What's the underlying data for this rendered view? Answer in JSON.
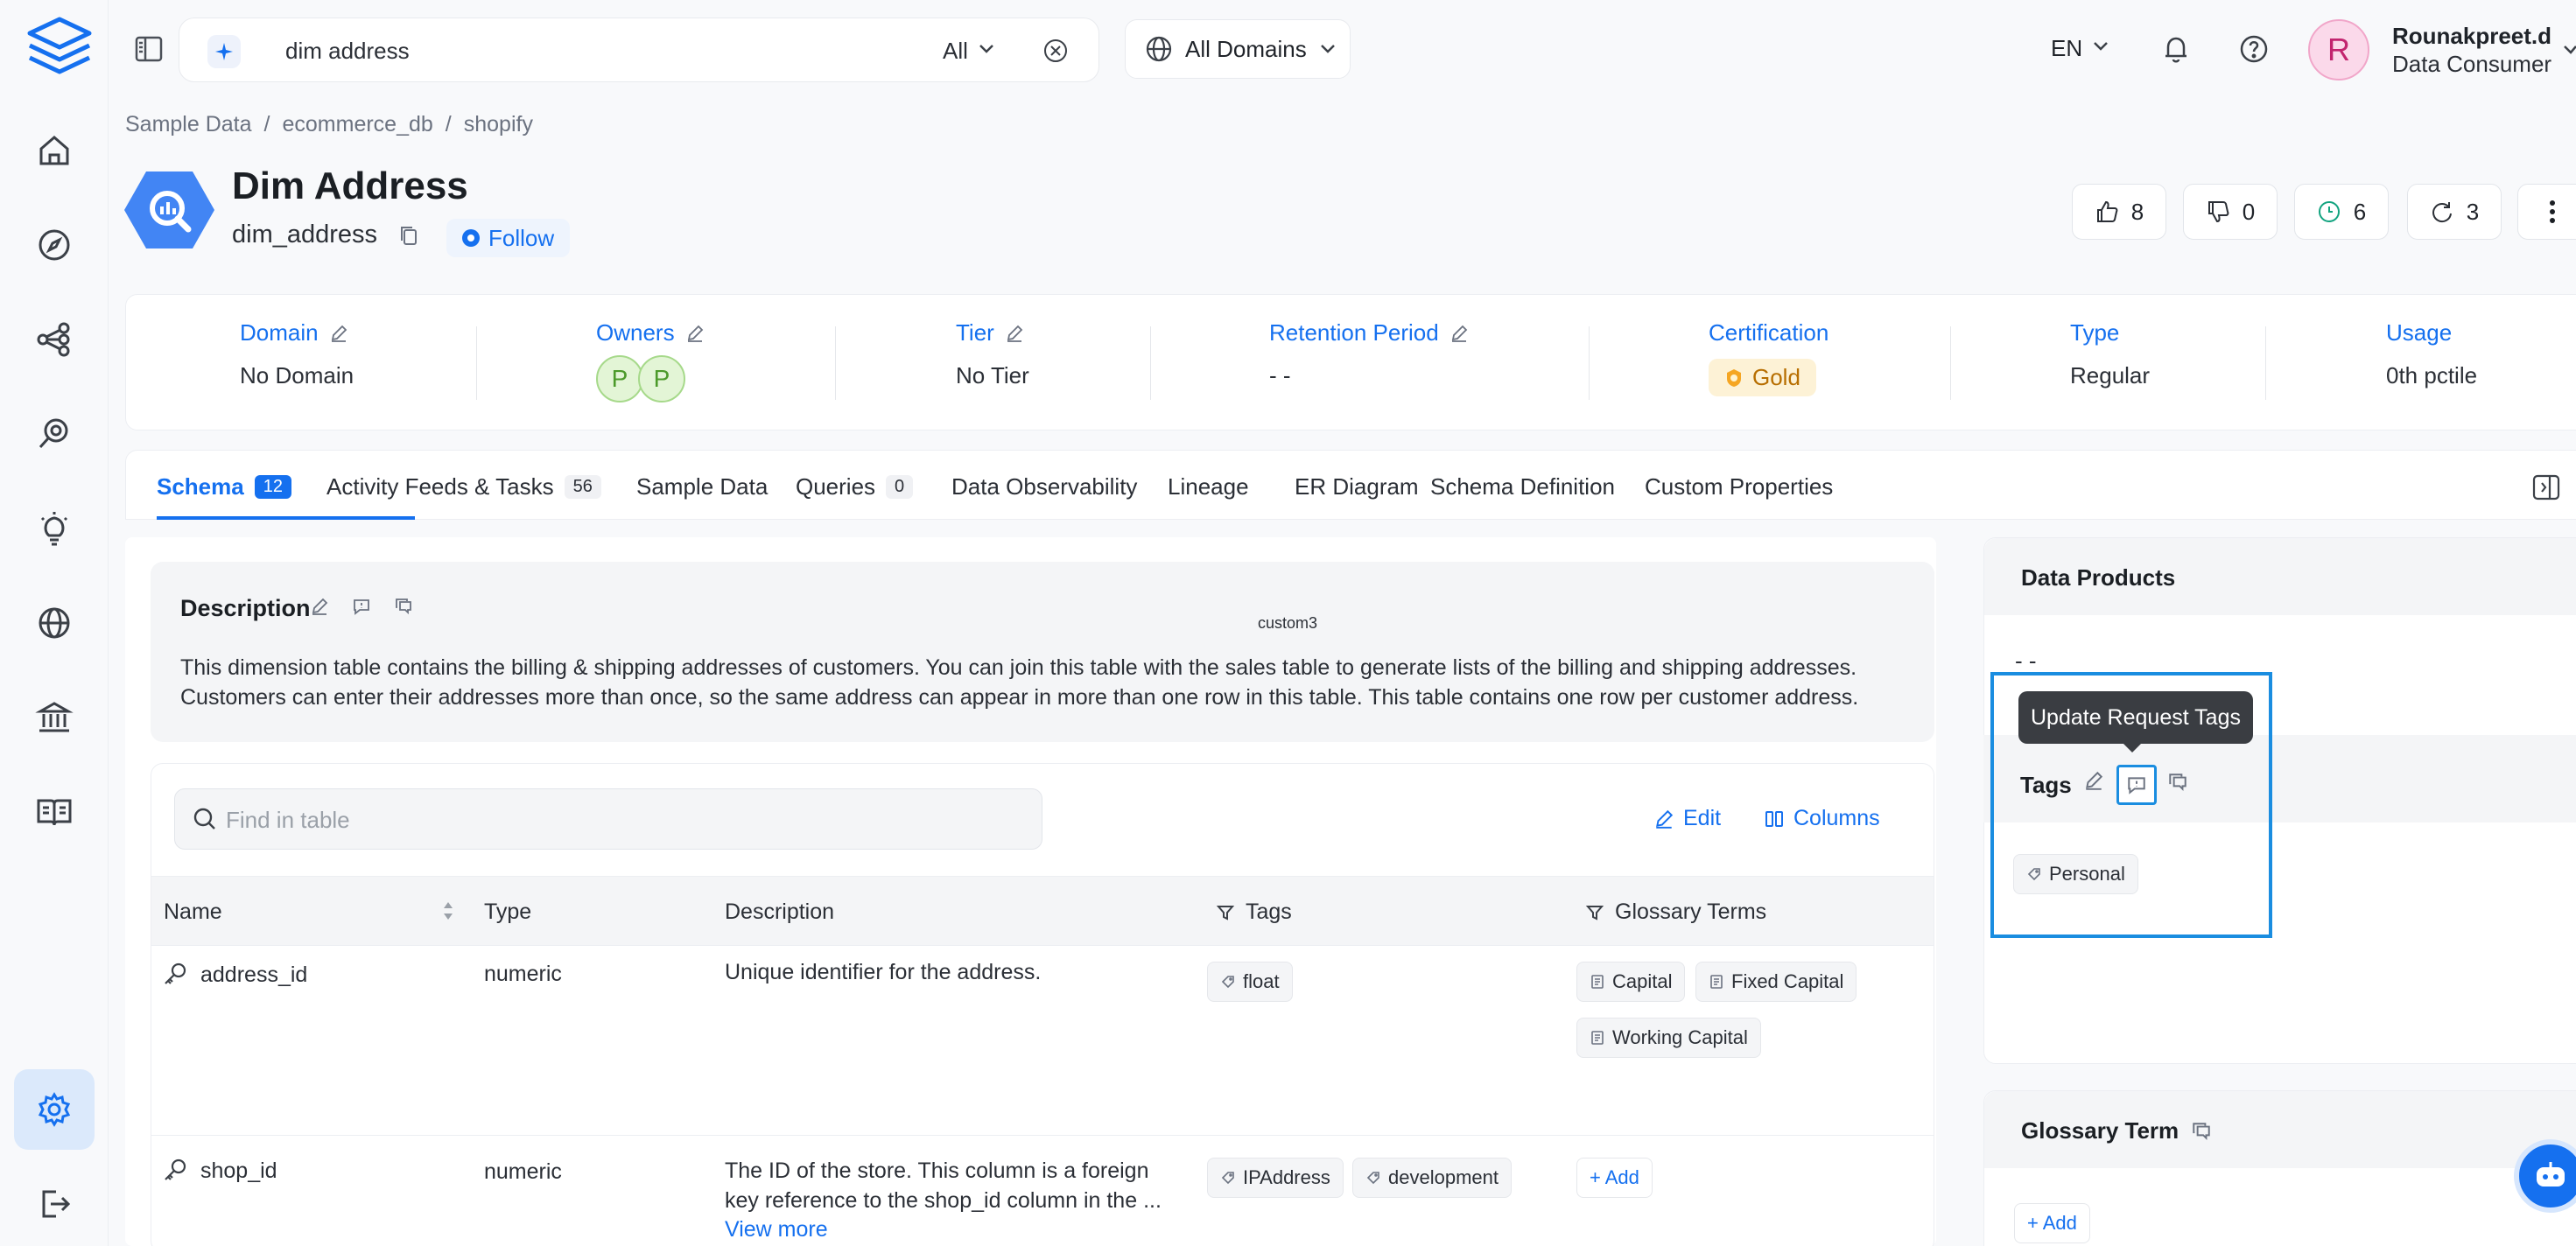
{
  "search": {
    "query": "dim address",
    "scope": "All"
  },
  "domains_label": "All Domains",
  "language": "EN",
  "user": {
    "initial": "R",
    "name": "Rounakpreet.d",
    "role": "Data Consumer"
  },
  "breadcrumbs": [
    "Sample Data",
    "ecommerce_db",
    "shopify"
  ],
  "breadcrumb_separator": "/",
  "entity": {
    "display_name": "Dim Address",
    "name": "dim_address",
    "follow_label": "Follow"
  },
  "stats": {
    "likes": "8",
    "dislikes": "0",
    "watchers": "6",
    "versions": "3"
  },
  "info": {
    "domain": {
      "label": "Domain",
      "value": "No Domain"
    },
    "owners": {
      "label": "Owners",
      "avatars": [
        "P",
        "P"
      ]
    },
    "tier": {
      "label": "Tier",
      "value": "No Tier"
    },
    "retention": {
      "label": "Retention Period",
      "value": "- -"
    },
    "certification": {
      "label": "Certification",
      "value": "Gold"
    },
    "type": {
      "label": "Type",
      "value": "Regular"
    },
    "usage": {
      "label": "Usage",
      "value": "0th pctile"
    }
  },
  "tabs": [
    {
      "label": "Schema",
      "count": "12"
    },
    {
      "label": "Activity Feeds & Tasks",
      "count": "56"
    },
    {
      "label": "Sample Data"
    },
    {
      "label": "Queries",
      "count": "0"
    },
    {
      "label": "Data Observability"
    },
    {
      "label": "Lineage"
    },
    {
      "label": "ER Diagram"
    },
    {
      "label": "Schema Definition"
    },
    {
      "label": "Custom Properties"
    }
  ],
  "description": {
    "title": "Description",
    "custom_label": "custom3",
    "text": "This dimension table contains the billing & shipping addresses of customers. You can join this table with the sales table to generate lists of the billing and shipping addresses. Customers can enter their addresses more than once, so the same address can appear in more than one row in this table. This table contains one row per customer address."
  },
  "table": {
    "find_placeholder": "Find in table",
    "edit_label": "Edit",
    "columns_label": "Columns",
    "headers": [
      "Name",
      "Type",
      "Description",
      "Tags",
      "Glossary Terms"
    ],
    "rows": [
      {
        "name": "address_id",
        "type": "numeric",
        "description": "Unique identifier for the address.",
        "tags": [
          "float"
        ],
        "glossary": [
          "Capital",
          "Fixed Capital",
          "Working Capital"
        ]
      },
      {
        "name": "shop_id",
        "type": "numeric",
        "description": "The ID of the store. This column is a foreign key reference to the shop_id column in the ...",
        "view_more": "View more",
        "tags": [
          "IPAddress",
          "development"
        ],
        "glossary_add": "+ Add"
      }
    ]
  },
  "right_panel": {
    "data_products": {
      "title": "Data Products",
      "value": "- -"
    },
    "tags": {
      "title": "Tags",
      "items": [
        "Personal"
      ],
      "tooltip": "Update Request Tags"
    },
    "glossary": {
      "title": "Glossary Term",
      "add_label": "+ Add"
    }
  },
  "colors": {
    "primary": "#1570ef",
    "highlight": "#1a8de0",
    "gold": "#b76e00"
  }
}
